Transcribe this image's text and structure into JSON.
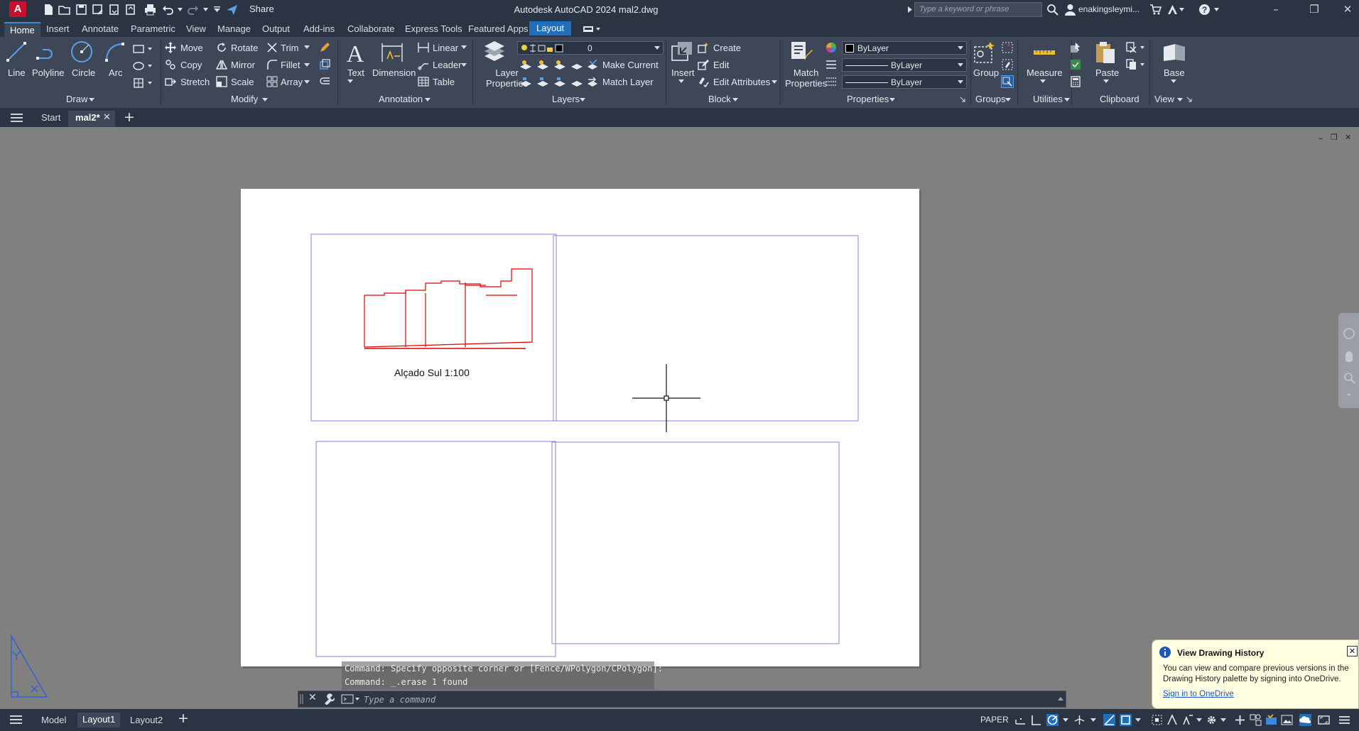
{
  "titlebar": {
    "app_logo": "A",
    "share_label": "Share",
    "window_title": "Autodesk AutoCAD 2024   mal2.dwg",
    "search_placeholder": "Type a keyword or phrase",
    "user": "enakingsleymi..."
  },
  "ribbon_tabs": [
    "Home",
    "Insert",
    "Annotate",
    "Parametric",
    "View",
    "Manage",
    "Output",
    "Add-ins",
    "Collaborate",
    "Express Tools",
    "Featured Apps",
    "Layout"
  ],
  "active_tab": "Home",
  "contextual_tab": "Layout",
  "panels": {
    "draw": {
      "title": "Draw",
      "line": "Line",
      "polyline": "Polyline",
      "circle": "Circle",
      "arc": "Arc"
    },
    "modify": {
      "title": "Modify",
      "move": "Move",
      "rotate": "Rotate",
      "trim": "Trim",
      "copy": "Copy",
      "mirror": "Mirror",
      "fillet": "Fillet",
      "stretch": "Stretch",
      "scale": "Scale",
      "array": "Array"
    },
    "annotation": {
      "title": "Annotation",
      "text": "Text",
      "dimension": "Dimension",
      "linear": "Linear",
      "leader": "Leader",
      "table": "Table"
    },
    "layers": {
      "title": "Layers",
      "layer_properties": "Layer\nProperties",
      "layer_current": "0",
      "make_current": "Make Current",
      "match_layer": "Match Layer"
    },
    "block": {
      "title": "Block",
      "insert": "Insert",
      "create": "Create",
      "edit": "Edit",
      "edit_attributes": "Edit Attributes"
    },
    "properties": {
      "title": "Properties",
      "match_properties": "Match\nProperties",
      "color": "ByLayer",
      "linetype": "ByLayer",
      "lineweight": "ByLayer"
    },
    "groups": {
      "title": "Groups",
      "group": "Group"
    },
    "utilities": {
      "title": "Utilities",
      "measure": "Measure"
    },
    "clipboard": {
      "title": "Clipboard",
      "paste": "Paste"
    },
    "view": {
      "title": "View",
      "base": "Base"
    }
  },
  "file_tabs": {
    "start": "Start",
    "doc": "mal2*"
  },
  "drawing": {
    "view_label": "Alçado Sul 1:100",
    "colors": {
      "elevation": "#e00000",
      "viewport": "#8a86d6",
      "paper": "#ffffff",
      "canvas": "#808080"
    }
  },
  "command_line": {
    "history": [
      "Command: Specify opposite corner or [Fence/WPolygon/CPolygon]:",
      "Command: _.erase 1 found"
    ],
    "placeholder": "Type a command"
  },
  "balloon": {
    "title": "View Drawing History",
    "body": "You can view and compare previous versions in the Drawing History palette by signing into OneDrive.",
    "link": "Sign in to OneDrive"
  },
  "layout_tabs": [
    "Model",
    "Layout1",
    "Layout2"
  ],
  "active_layout": "Layout1",
  "status": {
    "paper": "PAPER"
  }
}
